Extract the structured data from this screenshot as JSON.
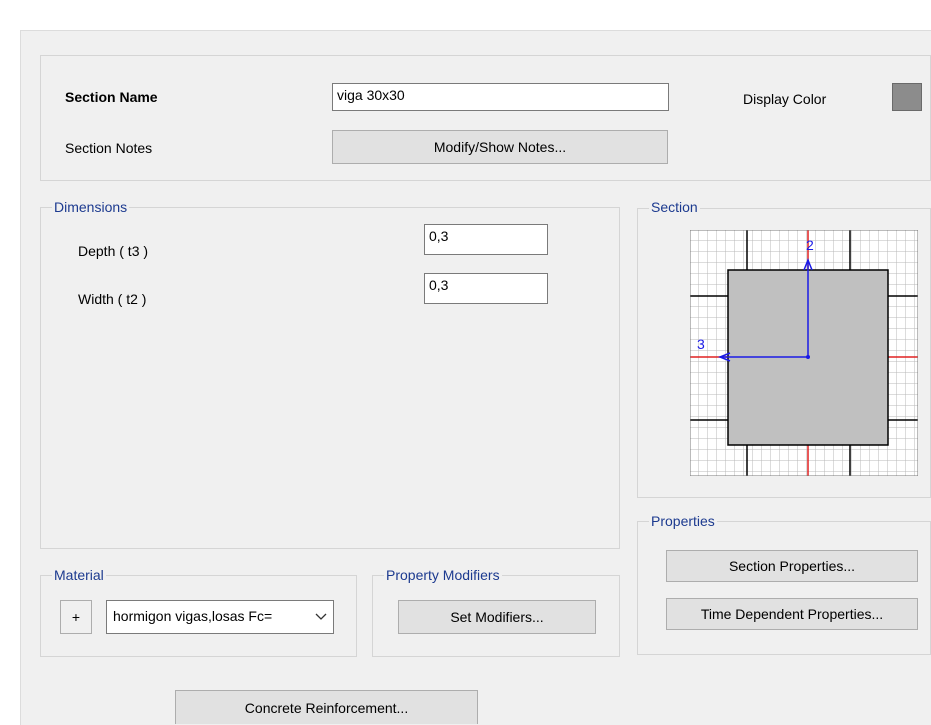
{
  "header": {
    "section_name_label": "Section Name",
    "section_name_value": "viga 30x30",
    "section_notes_label": "Section Notes",
    "modify_notes_button": "Modify/Show Notes...",
    "display_color_label": "Display Color",
    "display_color": "#8c8c8c"
  },
  "dimensions": {
    "title": "Dimensions",
    "depth_label": "Depth  ( t3 )",
    "depth_value": "0,3",
    "width_label": "Width  ( t2 )",
    "width_value": "0,3"
  },
  "section_preview": {
    "title": "Section",
    "axis_2_label": "2",
    "axis_3_label": "3"
  },
  "properties": {
    "title": "Properties",
    "section_properties_button": "Section Properties...",
    "time_dependent_button": "Time Dependent Properties..."
  },
  "material": {
    "title": "Material",
    "add_button": "+",
    "selected": "hormigon vigas,losas Fc="
  },
  "property_modifiers": {
    "title": "Property Modifiers",
    "set_modifiers_button": "Set Modifiers..."
  },
  "footer": {
    "concrete_reinforcement_button": "Concrete Reinforcement..."
  }
}
